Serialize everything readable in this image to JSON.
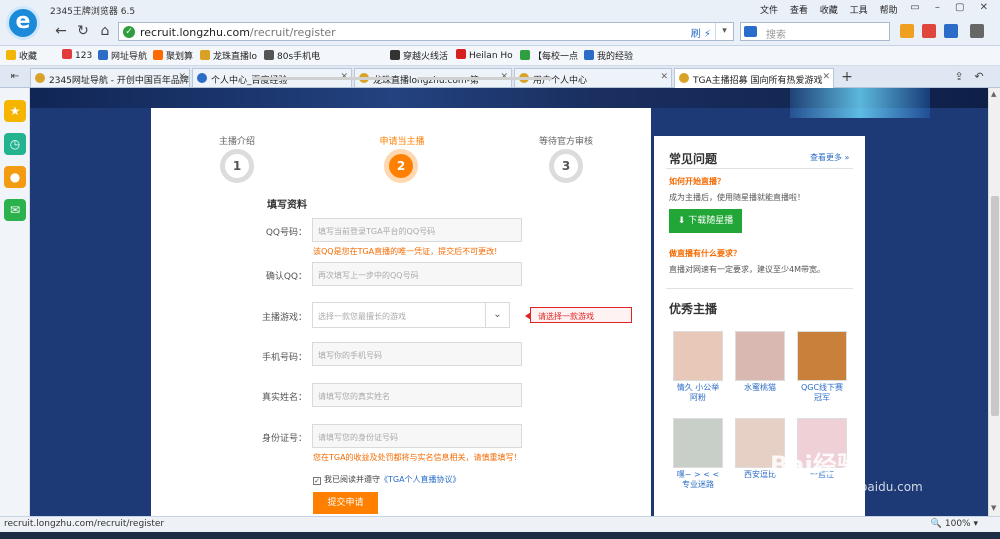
{
  "browser": {
    "title": "2345王牌浏览器 6.5",
    "url_host": "recruit.longzhu.com",
    "url_path": "/recruit/register",
    "search_placeholder": "搜索",
    "menus": [
      "文件",
      "查看",
      "收藏",
      "工具",
      "帮助"
    ],
    "addr_icons": "刷 ⚡",
    "win_controls": "▭ – ▢ ✕"
  },
  "favorites": [
    {
      "label": "收藏",
      "color": "#f2b705"
    },
    {
      "label": "123",
      "color": "#e23b3b"
    },
    {
      "label": "网址导航",
      "color": "#2b6cc6"
    },
    {
      "label": "聚划算",
      "color": "#ff6a00"
    },
    {
      "label": "龙珠直播lo",
      "color": "#d9a227"
    },
    {
      "label": "80s手机电",
      "color": "#555555"
    },
    {
      "label": "穿越火线活",
      "color": "#333333"
    },
    {
      "label": "Heilan Ho",
      "color": "#d61f1f"
    },
    {
      "label": "【每校一点",
      "color": "#2e9e3e"
    },
    {
      "label": "我的经验",
      "color": "#2b6cc6"
    }
  ],
  "tabs": [
    {
      "label": "2345网址导航 - 开创中国百年品牌",
      "active": false
    },
    {
      "label": "个人中心_百度经验",
      "active": false
    },
    {
      "label": "龙珠直播longzhu.com-第一",
      "active": false
    },
    {
      "label": "用户个人中心",
      "active": false
    },
    {
      "label": "TGA主播招募 国向所有热爱游戏",
      "active": true
    }
  ],
  "steps": [
    {
      "label": "主播介绍",
      "num": "1"
    },
    {
      "label": "申请当主播",
      "num": "2"
    },
    {
      "label": "等待官方审核",
      "num": "3"
    }
  ],
  "form": {
    "section_title": "填写资料",
    "qq_label": "QQ号码：",
    "qq_placeholder": "填写当前登录TGA平台的QQ号码",
    "qq_hint": "该QQ是您在TGA直播的唯一凭证，提交后不可更改!",
    "confirm_label": "确认QQ：",
    "confirm_placeholder": "再次填写上一步中的QQ号码",
    "game_label": "主播游戏：",
    "game_placeholder": "选择一款您最擅长的游戏",
    "game_error": "请选择一款游戏",
    "phone_label": "手机号码：",
    "phone_placeholder": "填写你的手机号码",
    "name_label": "真实姓名：",
    "name_placeholder": "请填写您的真实姓名",
    "id_label": "身份证号：",
    "id_placeholder": "请填写您的身份证号码",
    "id_hint": "您在TGA的收益及处罚都将与实名信息相关，请慎重填写！",
    "agree_text": "我已阅读并遵守",
    "agree_link": "《TGA个人直播协议》",
    "submit": "提交申请"
  },
  "faq": {
    "title": "常见问题",
    "more": "查看更多",
    "q1": "如何开始直播？",
    "a1": "成为主播后，使用随星播就能直播啦！",
    "download": "下载随星播",
    "q2": "做直播有什么要求？",
    "a2": "直播对网速有一定要求，建议至少4M带宽。"
  },
  "streamers": {
    "title": "优秀主播",
    "items": [
      {
        "name": "情久 小公举阿粉",
        "tone": "#e8c8b8"
      },
      {
        "name": "水蜜桃猫",
        "tone": "#d8b8b0"
      },
      {
        "name": "QGC线下赛冠军",
        "tone": "#c9803a"
      },
      {
        "name": "嘿~ > < < 专业迷路",
        "tone": "#c8cfc9"
      },
      {
        "name": "西安逗比",
        "tone": "#e6cfc4"
      },
      {
        "name": "一直在",
        "tone": "#efd0d6"
      }
    ]
  },
  "status": {
    "text": "recruit.longzhu.com/recruit/register",
    "zoom": "100%"
  },
  "watermark": {
    "main": "Bai经验",
    "sub": "jingyan.baidu.com"
  }
}
